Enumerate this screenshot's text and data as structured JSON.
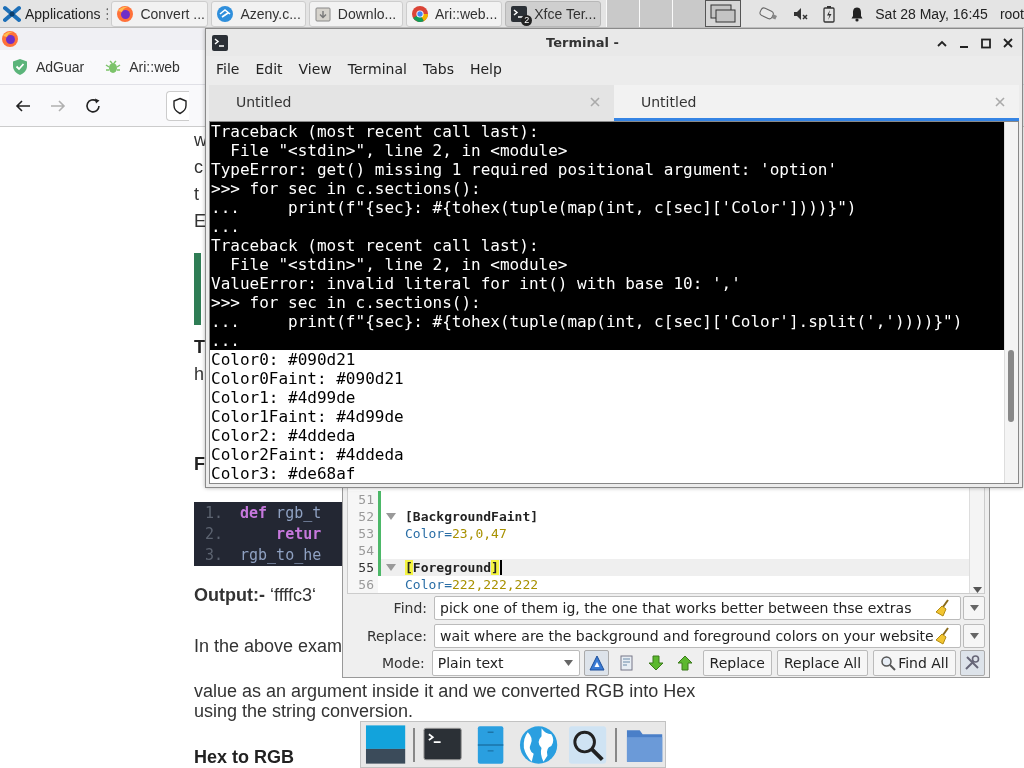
{
  "panel": {
    "apps_label": "Applications",
    "tasks": [
      {
        "kind": "firefox",
        "label": "Convert ...",
        "selected": false
      },
      {
        "kind": "azeny",
        "label": "Azeny.c...",
        "selected": false
      },
      {
        "kind": "downloads",
        "label": "Downlo...",
        "selected": false
      },
      {
        "kind": "chrome",
        "label": "Ari::web...",
        "selected": false
      },
      {
        "kind": "terminal",
        "label": "Xfce Ter...",
        "selected": true,
        "badge": "2"
      }
    ],
    "workspaces": [
      {
        "selected": false
      },
      {
        "selected": false
      },
      {
        "selected": false
      },
      {
        "selected": true
      }
    ],
    "tray": [
      {
        "kind": "usb"
      },
      {
        "kind": "volume-muted"
      },
      {
        "kind": "battery"
      },
      {
        "kind": "bell"
      }
    ],
    "clock": "Sat 28 May, 16:45",
    "user": "root"
  },
  "browser": {
    "bookmarks": [
      {
        "kind": "shield",
        "label": "AdGuar"
      },
      {
        "kind": "bug",
        "label": "Ari::web"
      }
    ],
    "nav": [
      {
        "kind": "back",
        "disabled": false
      },
      {
        "kind": "forward",
        "disabled": true
      },
      {
        "kind": "reload",
        "disabled": false
      }
    ],
    "page": [
      {
        "kind": "text",
        "text": "w"
      },
      {
        "kind": "text",
        "text": "c"
      },
      {
        "kind": "text",
        "text": "t"
      },
      {
        "kind": "text",
        "text": "E"
      },
      {
        "kind": "callout"
      },
      {
        "kind": "bold",
        "text": "T"
      },
      {
        "kind": "text",
        "text": "h"
      },
      {
        "kind": "heading",
        "text": "F"
      },
      {
        "kind": "code",
        "lines": [
          {
            "number": "1.",
            "tokens": [
              {
                "kind": "keyword",
                "text": "def"
              },
              {
                "kind": "name",
                "text": " rgb_t"
              }
            ]
          },
          {
            "number": "2.",
            "tokens": [
              {
                "kind": "keyword",
                "text": "    retur"
              }
            ]
          },
          {
            "number": "3.",
            "tokens": [
              {
                "kind": "name",
                "text": "rgb_to_he"
              }
            ]
          }
        ]
      },
      {
        "kind": "rich",
        "text": "**Output:-** ‘ffffc3‘"
      },
      {
        "kind": "text",
        "text": "In the above exam"
      },
      {
        "kind": "text",
        "text": "value as an argument inside it and we converted RGB into Hex"
      },
      {
        "kind": "text",
        "text": "using the string conversion."
      },
      {
        "kind": "heading",
        "text": "Hex to RGB"
      }
    ]
  },
  "terminal": {
    "title": "Terminal -",
    "menu": [
      "File",
      "Edit",
      "View",
      "Terminal",
      "Tabs",
      "Help"
    ],
    "tabs": [
      {
        "label": "Untitled",
        "selected": false
      },
      {
        "label": "Untitled",
        "selected": true
      }
    ],
    "lines": [
      {
        "kind": "dark",
        "text": "Traceback (most recent call last):"
      },
      {
        "kind": "dark",
        "text": "  File \"<stdin>\", line 2, in <module>"
      },
      {
        "kind": "dark",
        "text": "TypeError: get() missing 1 required positional argument: 'option'"
      },
      {
        "kind": "dark",
        "text": ">>> for sec in c.sections():"
      },
      {
        "kind": "dark",
        "text": "...     print(f\"{sec}: #{tohex(tuple(map(int, c[sec]['Color'])))}\")"
      },
      {
        "kind": "dark",
        "text": "..."
      },
      {
        "kind": "dark",
        "text": "Traceback (most recent call last):"
      },
      {
        "kind": "dark",
        "text": "  File \"<stdin>\", line 2, in <module>"
      },
      {
        "kind": "dark",
        "text": "ValueError: invalid literal for int() with base 10: ','"
      },
      {
        "kind": "dark",
        "text": ">>> for sec in c.sections():"
      },
      {
        "kind": "dark",
        "text": "...     print(f\"{sec}: #{tohex(tuple(map(int, c[sec]['Color'].split(','))))}\")"
      },
      {
        "kind": "dark",
        "text": "..."
      },
      {
        "kind": "light",
        "text": "Color0: #090d21"
      },
      {
        "kind": "light",
        "text": "Color0Faint: #090d21"
      },
      {
        "kind": "light",
        "text": "Color1: #4d99de"
      },
      {
        "kind": "light",
        "text": "Color1Faint: #4d99de"
      },
      {
        "kind": "light",
        "text": "Color2: #4ddeda"
      },
      {
        "kind": "light",
        "text": "Color2Faint: #4ddeda"
      },
      {
        "kind": "light",
        "text": "Color3: #de68af"
      }
    ]
  },
  "editor": {
    "lines": [
      {
        "number": "51",
        "kind": "blank",
        "fold": false,
        "modified": true,
        "current": false
      },
      {
        "number": "52",
        "kind": "section",
        "text": "[BackgroundFaint]",
        "fold": true,
        "modified": true,
        "current": false
      },
      {
        "number": "53",
        "kind": "pair",
        "key": "Color=",
        "value": "23,0,47",
        "fold": false,
        "modified": true,
        "current": false
      },
      {
        "number": "54",
        "kind": "blank",
        "fold": false,
        "modified": true,
        "current": false
      },
      {
        "number": "55",
        "kind": "section",
        "text": "[Foreground]",
        "fold": true,
        "modified": true,
        "current": true
      },
      {
        "number": "56",
        "kind": "pair",
        "key": "Color=",
        "value": "222,222,222",
        "fold": false,
        "modified": false,
        "current": false
      }
    ],
    "find": {
      "label": "Find:",
      "value": "pick one of them ig, the one that works better between thse extras"
    },
    "replace": {
      "label": "Replace:",
      "value": "wait where are the background and foreground colors on your website"
    },
    "mode": {
      "label": "Mode:",
      "value": "Plain text"
    },
    "tools": [
      {
        "kind": "match-case",
        "on": true
      },
      {
        "kind": "whole-word",
        "on": false
      },
      {
        "kind": "next",
        "on": false
      },
      {
        "kind": "previous",
        "on": false
      }
    ],
    "buttons": [
      {
        "label": "Replace",
        "icon": false
      },
      {
        "label": "Replace All",
        "icon": false
      },
      {
        "label": "Find All",
        "icon": true
      }
    ],
    "settings_on": true
  },
  "dock": [
    {
      "kind": "show-desktop"
    },
    {
      "kind": "separator"
    },
    {
      "kind": "terminal"
    },
    {
      "kind": "file-cabinet"
    },
    {
      "kind": "globe"
    },
    {
      "kind": "search"
    },
    {
      "kind": "separator"
    },
    {
      "kind": "folder"
    }
  ]
}
